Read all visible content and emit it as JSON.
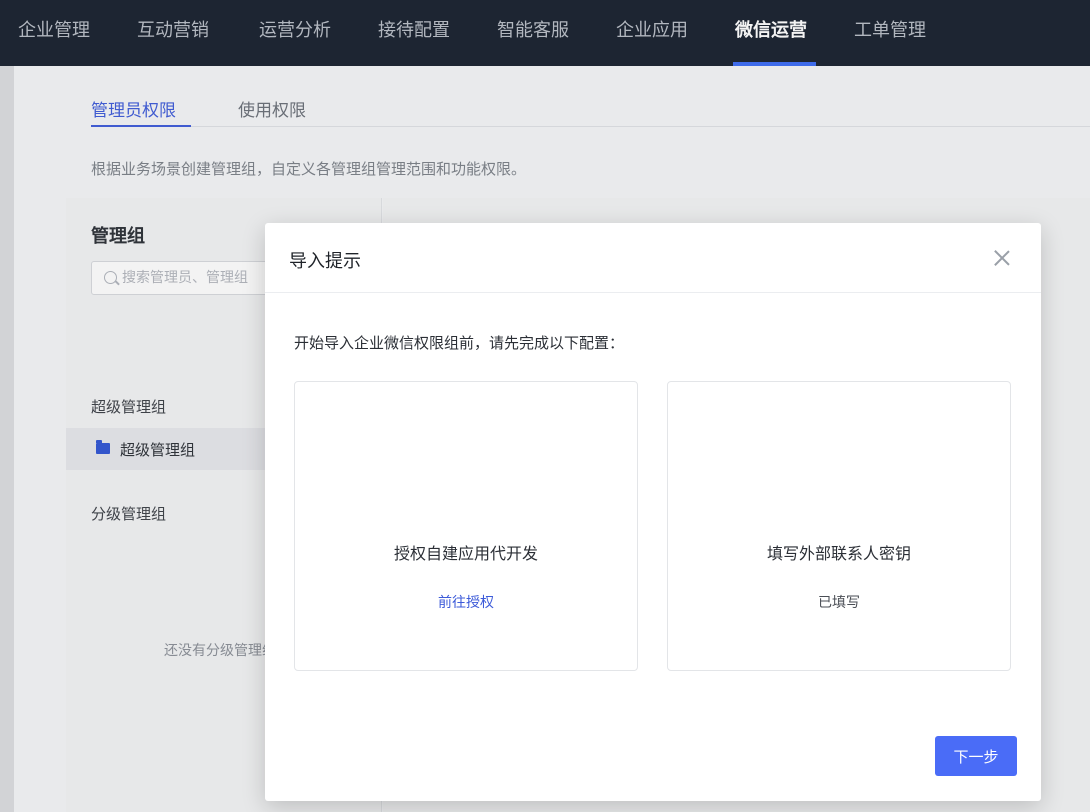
{
  "topnav": {
    "items": [
      {
        "label": "企业管理",
        "active": false
      },
      {
        "label": "互动营销",
        "active": false
      },
      {
        "label": "运营分析",
        "active": false
      },
      {
        "label": "接待配置",
        "active": false
      },
      {
        "label": "智能客服",
        "active": false
      },
      {
        "label": "企业应用",
        "active": false
      },
      {
        "label": "微信运营",
        "active": true
      },
      {
        "label": "工单管理",
        "active": false
      }
    ]
  },
  "tabs": [
    {
      "label": "管理员权限",
      "active": true
    },
    {
      "label": "使用权限",
      "active": false
    }
  ],
  "description": "根据业务场景创建管理组，自定义各管理组管理范围和功能权限。",
  "left_panel": {
    "title": "管理组",
    "search_placeholder": "搜索管理员、管理组",
    "super_section": "超级管理组",
    "super_item": "超级管理组",
    "sub_section": "分级管理组",
    "empty_text": "还没有分级管理组"
  },
  "modal": {
    "title": "导入提示",
    "intro": "开始导入企业微信权限组前，请先完成以下配置：",
    "cards": [
      {
        "title": "授权自建应用代开发",
        "action": "前往授权"
      },
      {
        "title": "填写外部联系人密钥",
        "status": "已填写"
      }
    ],
    "next_label": "下一步"
  },
  "colors": {
    "nav_bg": "#17202e",
    "accent": "#3d5bd9",
    "primary_button": "#4a6cf7"
  }
}
